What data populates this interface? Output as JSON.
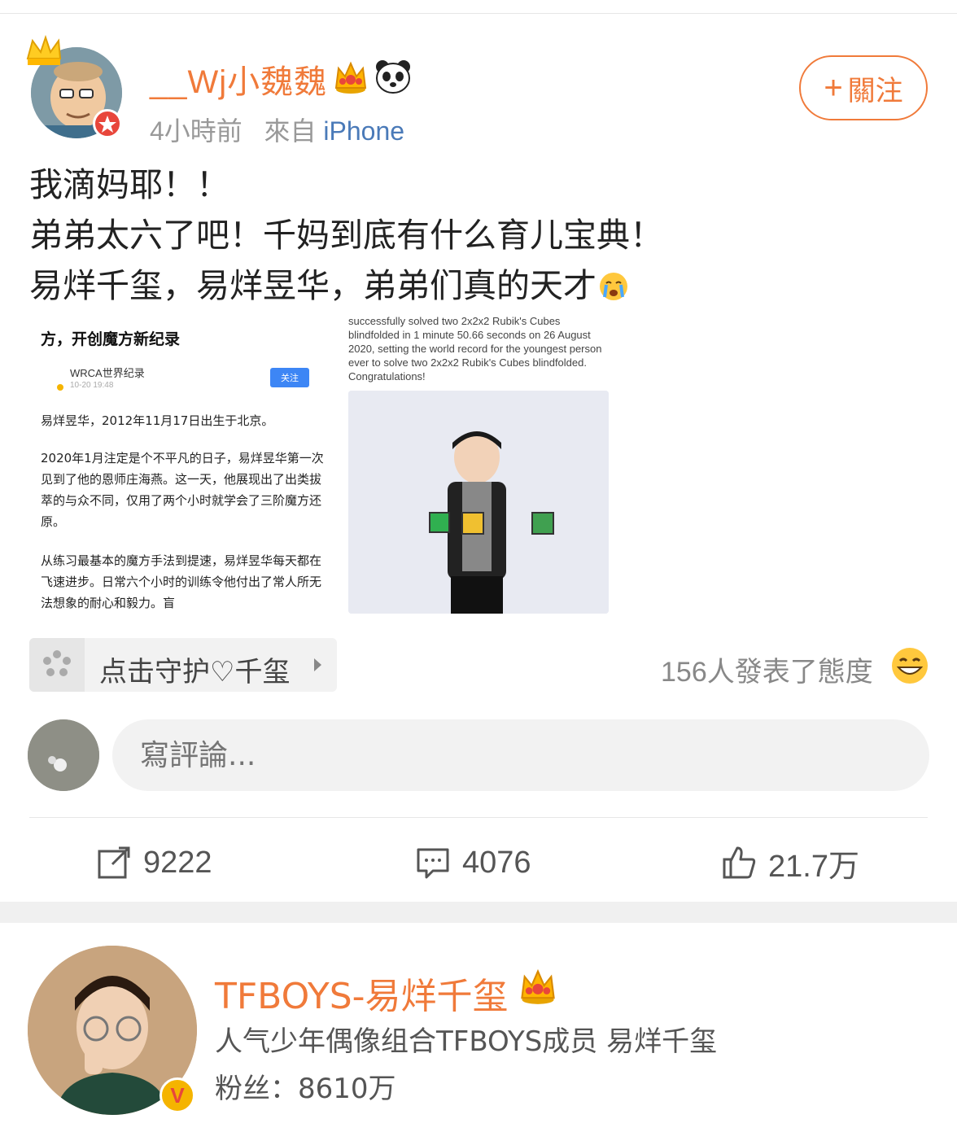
{
  "post": {
    "author": {
      "name": "__Wj小魏魏",
      "badges": [
        "crown-badge",
        "panda-badge"
      ],
      "time": "4小時前",
      "source_prefix": "來自",
      "source": "iPhone"
    },
    "follow_button": {
      "plus": "+",
      "label": "關注"
    },
    "text_lines": [
      "我滴妈耶！！",
      "弟弟太六了吧！千妈到底有什么育儿宝典！",
      "易烊千玺，易烊昱华，弟弟们真的天才"
    ],
    "emoji": "crying-face-icon",
    "images": {
      "left": {
        "headline": "方，开创魔方新纪录",
        "account": "WRCA世界纪录",
        "date": "10-20 19:48",
        "follow_label": "关注",
        "paragraphs": [
          "易烊昱华，2012年11月17日出生于北京。",
          "2020年1月注定是个不平凡的日子，易烊昱华第一次见到了他的恩师庄海燕。这一天，他展现出了出类拔萃的与众不同，仅用了两个小时就学会了三阶魔方还原。",
          "从练习最基本的魔方手法到提速，易烊昱华每天都在飞速进步。日常六个小时的训练令他付出了常人所无法想象的耐心和毅力。盲"
        ]
      },
      "right": {
        "english_text": "successfully solved two 2x2x2 Rubik's Cubes blindfolded in 1 minute 50.66 seconds on 26 August 2020, setting the world record for the youngest person ever to solve two 2x2x2 Rubik's Cubes blindfolded. Congratulations!"
      }
    },
    "super_topic": {
      "label": "点击守护♡千玺"
    },
    "reactions": {
      "text": "156人發表了態度"
    },
    "comment_placeholder": "寫評論...",
    "actions": {
      "repost": "9222",
      "comment": "4076",
      "like": "21.7万"
    }
  },
  "related_user": {
    "name": "TFBOYS-易烊千玺",
    "description": "人气少年偶像组合TFBOYS成员 易烊千玺",
    "fans": "粉丝：8610万",
    "verified_glyph": "V"
  },
  "colors": {
    "accent": "#f07a3a",
    "link": "#4a7ab8",
    "verified": "#f5b400"
  }
}
